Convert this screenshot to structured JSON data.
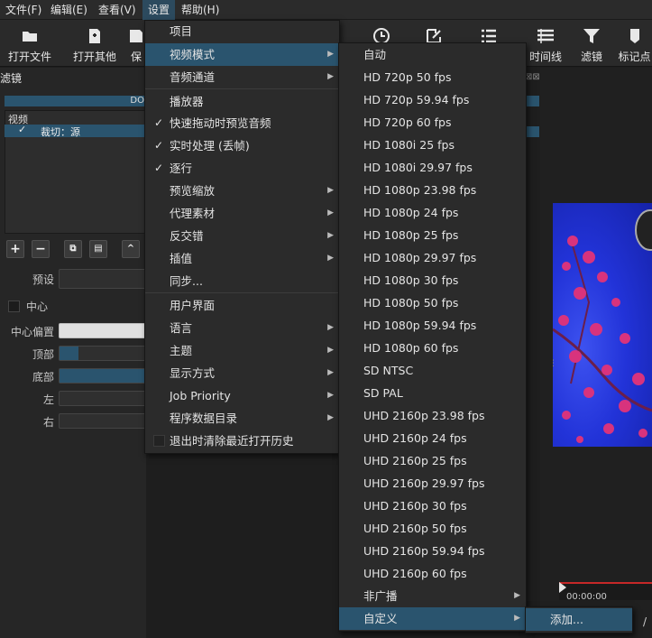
{
  "menubar": {
    "items": [
      "文件(F)",
      "编辑(E)",
      "查看(V)",
      "设置",
      "帮助(H)"
    ]
  },
  "toolbar": {
    "left": [
      {
        "label": "打开文件",
        "icon": "folder-icon"
      },
      {
        "label": "打开其他",
        "icon": "open-other-icon"
      },
      {
        "label": "保",
        "icon": "save-icon"
      }
    ],
    "right": [
      {
        "label": "",
        "icon": "clock-icon"
      },
      {
        "label": "",
        "icon": "edit-icon"
      },
      {
        "label": "",
        "icon": "list-icon"
      },
      {
        "label": "时间线",
        "icon": "timeline-icon"
      },
      {
        "label": "滤镜",
        "icon": "filter-icon"
      },
      {
        "label": "标记点",
        "icon": "marker-icon"
      }
    ]
  },
  "filters": {
    "title": "滤镜",
    "banner": "DO",
    "section": "视频",
    "item": "裁切：源",
    "preset_label": "预设",
    "center_label": "中心",
    "center_bias_label": "中心偏置",
    "top_label": "顶部",
    "bottom_label": "底部",
    "left_label": "左",
    "right_label": "右",
    "top_value": 0.22,
    "bottom_value": 1.0,
    "center_bias_value": 1.0
  },
  "settings_menu": {
    "items": [
      {
        "label": "项目",
        "type": "section"
      },
      {
        "label": "视频模式",
        "type": "submenu",
        "selected": true
      },
      {
        "label": "音频通道",
        "type": "submenu"
      },
      {
        "label": "播放器",
        "type": "section"
      },
      {
        "label": "快速拖动时预览音频",
        "type": "check",
        "checked": true
      },
      {
        "label": "实时处理 (丢帧)",
        "type": "check",
        "checked": true
      },
      {
        "label": "逐行",
        "type": "check",
        "checked": true
      },
      {
        "label": "预览缩放",
        "type": "submenu"
      },
      {
        "label": "代理素材",
        "type": "submenu"
      },
      {
        "label": "反交错",
        "type": "submenu"
      },
      {
        "label": "插值",
        "type": "submenu"
      },
      {
        "label": "同步...",
        "type": "item"
      },
      {
        "label": "用户界面",
        "type": "section"
      },
      {
        "label": "语言",
        "type": "submenu"
      },
      {
        "label": "主题",
        "type": "submenu"
      },
      {
        "label": "显示方式",
        "type": "submenu"
      },
      {
        "label": "Job Priority",
        "type": "submenu"
      },
      {
        "label": "程序数据目录",
        "type": "submenu"
      },
      {
        "label": "退出时清除最近打开历史",
        "type": "check",
        "checked": false
      }
    ]
  },
  "video_mode_menu": {
    "items": [
      "自动",
      "HD 720p 50 fps",
      "HD 720p 59.94 fps",
      "HD 720p 60 fps",
      "HD 1080i 25 fps",
      "HD 1080i 29.97 fps",
      "HD 1080p 23.98 fps",
      "HD 1080p 24 fps",
      "HD 1080p 25 fps",
      "HD 1080p 29.97 fps",
      "HD 1080p 30 fps",
      "HD 1080p 50 fps",
      "HD 1080p 59.94 fps",
      "HD 1080p 60 fps",
      "SD NTSC",
      "SD PAL",
      "UHD 2160p 23.98 fps",
      "UHD 2160p 24 fps",
      "UHD 2160p 25 fps",
      "UHD 2160p 29.97 fps",
      "UHD 2160p 30 fps",
      "UHD 2160p 50 fps",
      "UHD 2160p 59.94 fps",
      "UHD 2160p 60 fps"
    ],
    "submenus": [
      {
        "label": "非广播"
      },
      {
        "label": "自定义",
        "selected": true
      }
    ]
  },
  "custom_menu": {
    "items": [
      {
        "label": "添加...",
        "selected": true
      }
    ]
  },
  "timeline": {
    "timecode": "00:00:00",
    "slash": "/"
  },
  "colors": {
    "accent": "#2a546e",
    "menubar_active": "#2c4a5e",
    "video_bg": "#2233d8"
  }
}
